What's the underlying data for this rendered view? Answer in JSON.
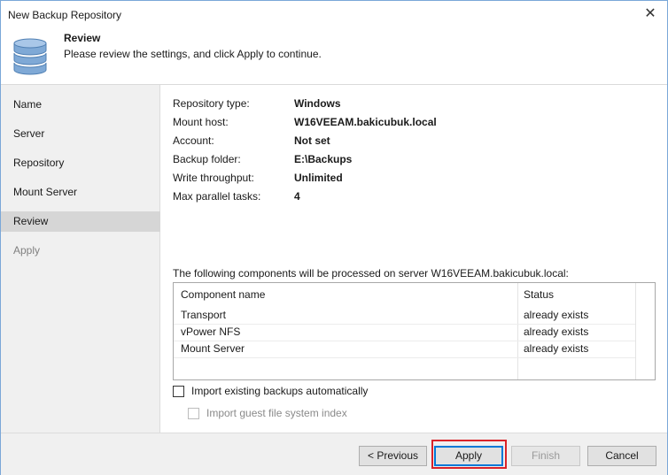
{
  "window": {
    "title": "New Backup Repository",
    "close_glyph": "✕"
  },
  "header": {
    "title": "Review",
    "subtitle": "Please review the settings, and click Apply to continue.",
    "icon": "database-icon"
  },
  "sidebar": {
    "items": [
      {
        "label": "Name"
      },
      {
        "label": "Server"
      },
      {
        "label": "Repository"
      },
      {
        "label": "Mount Server"
      },
      {
        "label": "Review"
      },
      {
        "label": "Apply"
      }
    ],
    "active_index": 4
  },
  "summary": {
    "rows": [
      {
        "label": "Repository type:",
        "value": "Windows"
      },
      {
        "label": "Mount host:",
        "value": "W16VEEAM.bakicubuk.local"
      },
      {
        "label": "Account:",
        "value": "Not set"
      },
      {
        "label": "Backup folder:",
        "value": "E:\\Backups"
      },
      {
        "label": "Write throughput:",
        "value": "Unlimited"
      },
      {
        "label": "Max parallel tasks:",
        "value": "4"
      }
    ]
  },
  "components": {
    "caption": "The following components will be processed on server W16VEEAM.bakicubuk.local:",
    "columns": [
      "Component name",
      "Status"
    ],
    "rows": [
      {
        "name": "Transport",
        "status": "already exists"
      },
      {
        "name": "vPower NFS",
        "status": "already exists"
      },
      {
        "name": "Mount Server",
        "status": "already exists"
      }
    ]
  },
  "options": {
    "import_existing": {
      "label": "Import existing backups automatically",
      "checked": false
    },
    "import_guest": {
      "label": "Import guest file system index",
      "checked": false,
      "disabled": true
    }
  },
  "buttons": {
    "previous": "< Previous",
    "apply": "Apply",
    "finish": "Finish",
    "cancel": "Cancel"
  },
  "colors": {
    "highlight": "#d9232a",
    "default_button_border": "#0078d7",
    "sidebar_bg": "#f0f0f0",
    "sidebar_active_bg": "#d6d6d6"
  }
}
